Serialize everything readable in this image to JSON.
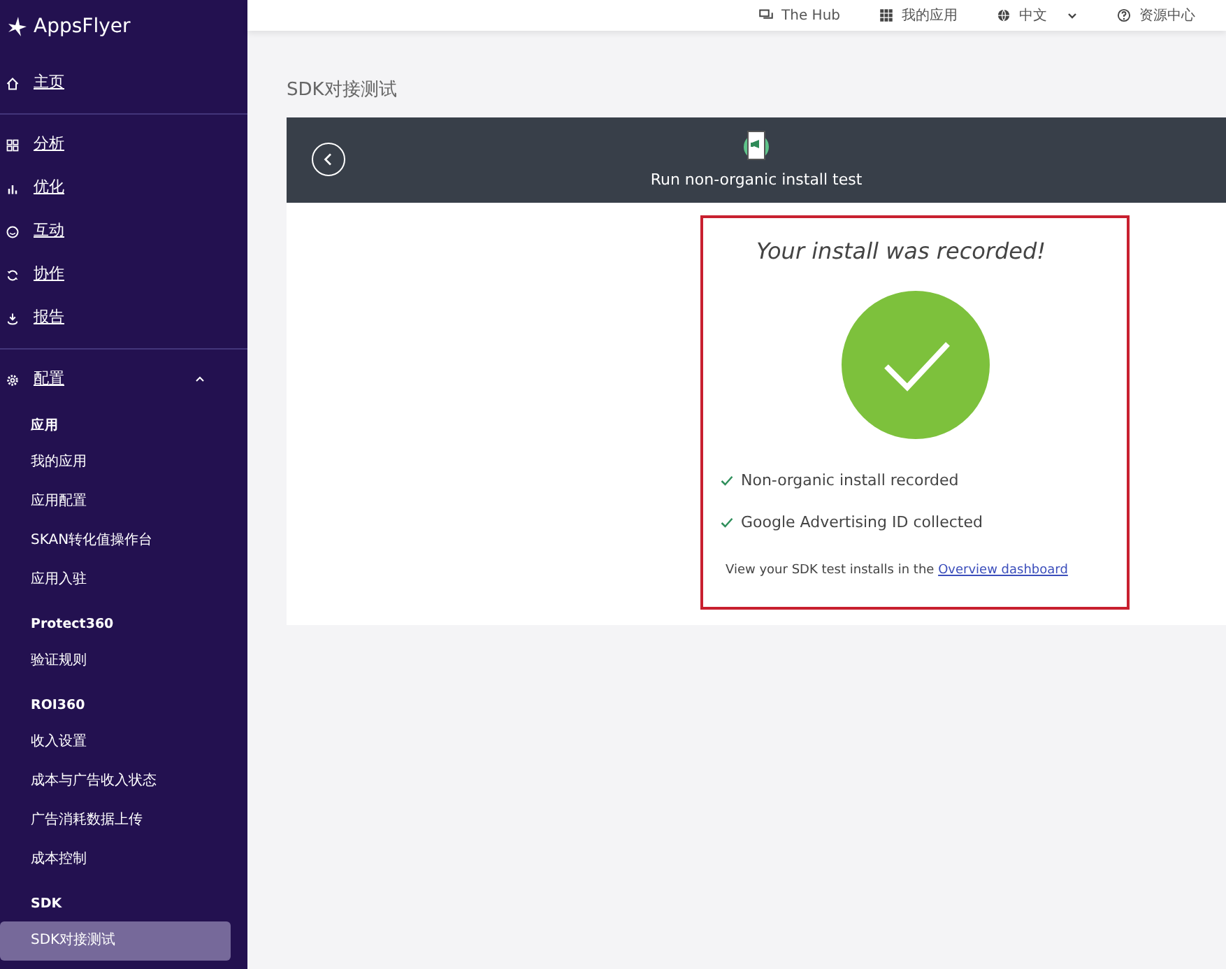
{
  "sidebar": {
    "logo": "AppsFlyer",
    "groups": [
      {
        "items": [
          {
            "label": "主页"
          }
        ]
      },
      {
        "items": [
          {
            "label": "分析"
          },
          {
            "label": "优化"
          },
          {
            "label": "互动"
          },
          {
            "label": "协作"
          },
          {
            "label": "报告"
          }
        ]
      },
      {
        "items": [
          {
            "label": "配置",
            "expanded": true,
            "children": [
              {
                "kind": "heading",
                "label": "应用"
              },
              {
                "kind": "link",
                "label": "我的应用",
                "selected": false
              },
              {
                "kind": "link",
                "label": "应用配置",
                "selected": false
              },
              {
                "kind": "link",
                "label": "SKAN转化值操作台",
                "selected": false
              },
              {
                "kind": "link",
                "label": "应用入驻",
                "selected": false
              },
              {
                "kind": "heading",
                "label": "Protect360"
              },
              {
                "kind": "link",
                "label": "验证规则",
                "selected": false
              },
              {
                "kind": "heading",
                "label": "ROI360"
              },
              {
                "kind": "link",
                "label": "收入设置",
                "selected": false
              },
              {
                "kind": "link",
                "label": "成本与广告收入状态",
                "selected": false
              },
              {
                "kind": "link",
                "label": "广告消耗数据上传",
                "selected": false
              },
              {
                "kind": "link",
                "label": "成本控制",
                "selected": false
              },
              {
                "kind": "heading",
                "label": "SDK"
              },
              {
                "kind": "link",
                "label": "SDK对接测试",
                "selected": true
              }
            ]
          }
        ]
      }
    ]
  },
  "topbar": [
    {
      "kind": "hub",
      "label": "The Hub"
    },
    {
      "kind": "apps",
      "label": "我的应用"
    },
    {
      "kind": "language",
      "label": "中文"
    },
    {
      "kind": "help",
      "label": "资源中心"
    }
  ],
  "page_title": "SDK对接测试",
  "test": {
    "title": "Run non-organic install test",
    "result_title": "Your install was recorded!",
    "checks": [
      {
        "label": "Non-organic install recorded",
        "checked": true
      },
      {
        "label": "Google Advertising ID collected",
        "checked": true
      }
    ],
    "footer": "View your SDK test installs in the",
    "footer_link": "Overview dashboard"
  }
}
